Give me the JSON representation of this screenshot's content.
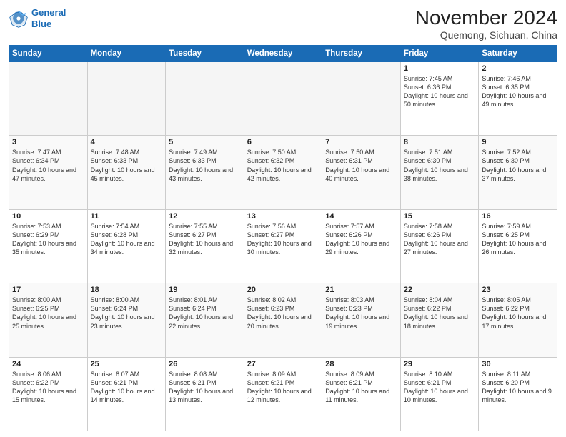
{
  "logo": {
    "line1": "General",
    "line2": "Blue"
  },
  "header": {
    "month": "November 2024",
    "location": "Quemong, Sichuan, China"
  },
  "weekdays": [
    "Sunday",
    "Monday",
    "Tuesday",
    "Wednesday",
    "Thursday",
    "Friday",
    "Saturday"
  ],
  "weeks": [
    [
      {
        "day": "",
        "info": ""
      },
      {
        "day": "",
        "info": ""
      },
      {
        "day": "",
        "info": ""
      },
      {
        "day": "",
        "info": ""
      },
      {
        "day": "",
        "info": ""
      },
      {
        "day": "1",
        "info": "Sunrise: 7:45 AM\nSunset: 6:36 PM\nDaylight: 10 hours and 50 minutes."
      },
      {
        "day": "2",
        "info": "Sunrise: 7:46 AM\nSunset: 6:35 PM\nDaylight: 10 hours and 49 minutes."
      }
    ],
    [
      {
        "day": "3",
        "info": "Sunrise: 7:47 AM\nSunset: 6:34 PM\nDaylight: 10 hours and 47 minutes."
      },
      {
        "day": "4",
        "info": "Sunrise: 7:48 AM\nSunset: 6:33 PM\nDaylight: 10 hours and 45 minutes."
      },
      {
        "day": "5",
        "info": "Sunrise: 7:49 AM\nSunset: 6:33 PM\nDaylight: 10 hours and 43 minutes."
      },
      {
        "day": "6",
        "info": "Sunrise: 7:50 AM\nSunset: 6:32 PM\nDaylight: 10 hours and 42 minutes."
      },
      {
        "day": "7",
        "info": "Sunrise: 7:50 AM\nSunset: 6:31 PM\nDaylight: 10 hours and 40 minutes."
      },
      {
        "day": "8",
        "info": "Sunrise: 7:51 AM\nSunset: 6:30 PM\nDaylight: 10 hours and 38 minutes."
      },
      {
        "day": "9",
        "info": "Sunrise: 7:52 AM\nSunset: 6:30 PM\nDaylight: 10 hours and 37 minutes."
      }
    ],
    [
      {
        "day": "10",
        "info": "Sunrise: 7:53 AM\nSunset: 6:29 PM\nDaylight: 10 hours and 35 minutes."
      },
      {
        "day": "11",
        "info": "Sunrise: 7:54 AM\nSunset: 6:28 PM\nDaylight: 10 hours and 34 minutes."
      },
      {
        "day": "12",
        "info": "Sunrise: 7:55 AM\nSunset: 6:27 PM\nDaylight: 10 hours and 32 minutes."
      },
      {
        "day": "13",
        "info": "Sunrise: 7:56 AM\nSunset: 6:27 PM\nDaylight: 10 hours and 30 minutes."
      },
      {
        "day": "14",
        "info": "Sunrise: 7:57 AM\nSunset: 6:26 PM\nDaylight: 10 hours and 29 minutes."
      },
      {
        "day": "15",
        "info": "Sunrise: 7:58 AM\nSunset: 6:26 PM\nDaylight: 10 hours and 27 minutes."
      },
      {
        "day": "16",
        "info": "Sunrise: 7:59 AM\nSunset: 6:25 PM\nDaylight: 10 hours and 26 minutes."
      }
    ],
    [
      {
        "day": "17",
        "info": "Sunrise: 8:00 AM\nSunset: 6:25 PM\nDaylight: 10 hours and 25 minutes."
      },
      {
        "day": "18",
        "info": "Sunrise: 8:00 AM\nSunset: 6:24 PM\nDaylight: 10 hours and 23 minutes."
      },
      {
        "day": "19",
        "info": "Sunrise: 8:01 AM\nSunset: 6:24 PM\nDaylight: 10 hours and 22 minutes."
      },
      {
        "day": "20",
        "info": "Sunrise: 8:02 AM\nSunset: 6:23 PM\nDaylight: 10 hours and 20 minutes."
      },
      {
        "day": "21",
        "info": "Sunrise: 8:03 AM\nSunset: 6:23 PM\nDaylight: 10 hours and 19 minutes."
      },
      {
        "day": "22",
        "info": "Sunrise: 8:04 AM\nSunset: 6:22 PM\nDaylight: 10 hours and 18 minutes."
      },
      {
        "day": "23",
        "info": "Sunrise: 8:05 AM\nSunset: 6:22 PM\nDaylight: 10 hours and 17 minutes."
      }
    ],
    [
      {
        "day": "24",
        "info": "Sunrise: 8:06 AM\nSunset: 6:22 PM\nDaylight: 10 hours and 15 minutes."
      },
      {
        "day": "25",
        "info": "Sunrise: 8:07 AM\nSunset: 6:21 PM\nDaylight: 10 hours and 14 minutes."
      },
      {
        "day": "26",
        "info": "Sunrise: 8:08 AM\nSunset: 6:21 PM\nDaylight: 10 hours and 13 minutes."
      },
      {
        "day": "27",
        "info": "Sunrise: 8:09 AM\nSunset: 6:21 PM\nDaylight: 10 hours and 12 minutes."
      },
      {
        "day": "28",
        "info": "Sunrise: 8:09 AM\nSunset: 6:21 PM\nDaylight: 10 hours and 11 minutes."
      },
      {
        "day": "29",
        "info": "Sunrise: 8:10 AM\nSunset: 6:21 PM\nDaylight: 10 hours and 10 minutes."
      },
      {
        "day": "30",
        "info": "Sunrise: 8:11 AM\nSunset: 6:20 PM\nDaylight: 10 hours and 9 minutes."
      }
    ]
  ]
}
